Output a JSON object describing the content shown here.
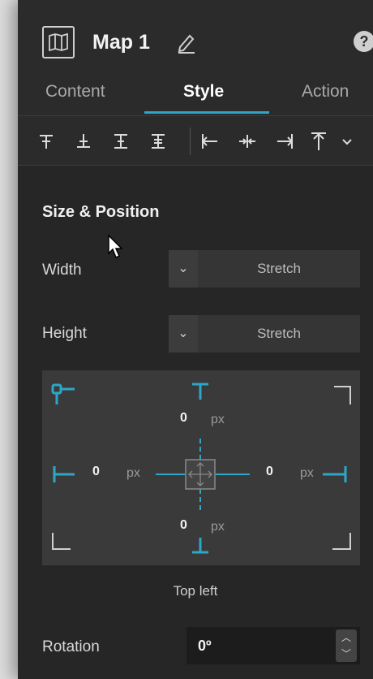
{
  "header": {
    "title": "Map 1"
  },
  "tabs": [
    {
      "label": "Content",
      "active": false
    },
    {
      "label": "Style",
      "active": true
    },
    {
      "label": "Action",
      "active": false
    }
  ],
  "align_toolbar": {
    "icons": [
      "align-top-icon",
      "align-middle-icon",
      "align-bottom-icon",
      "distribute-vertical-icon",
      "align-left-icon",
      "align-center-icon",
      "align-right-icon",
      "align-to-top-icon",
      "chevron-down-icon"
    ]
  },
  "size_position": {
    "section_title": "Size & Position",
    "width_label": "Width",
    "width_value": "Stretch",
    "height_label": "Height",
    "height_value": "Stretch",
    "top_value": "0",
    "bottom_value": "0",
    "left_value": "0",
    "right_value": "0",
    "unit": "px",
    "anchor": "Top left"
  },
  "rotation": {
    "label": "Rotation",
    "value": "0º"
  },
  "colors": {
    "accent": "#2ea6c7",
    "panel": "#2b2b2b"
  }
}
